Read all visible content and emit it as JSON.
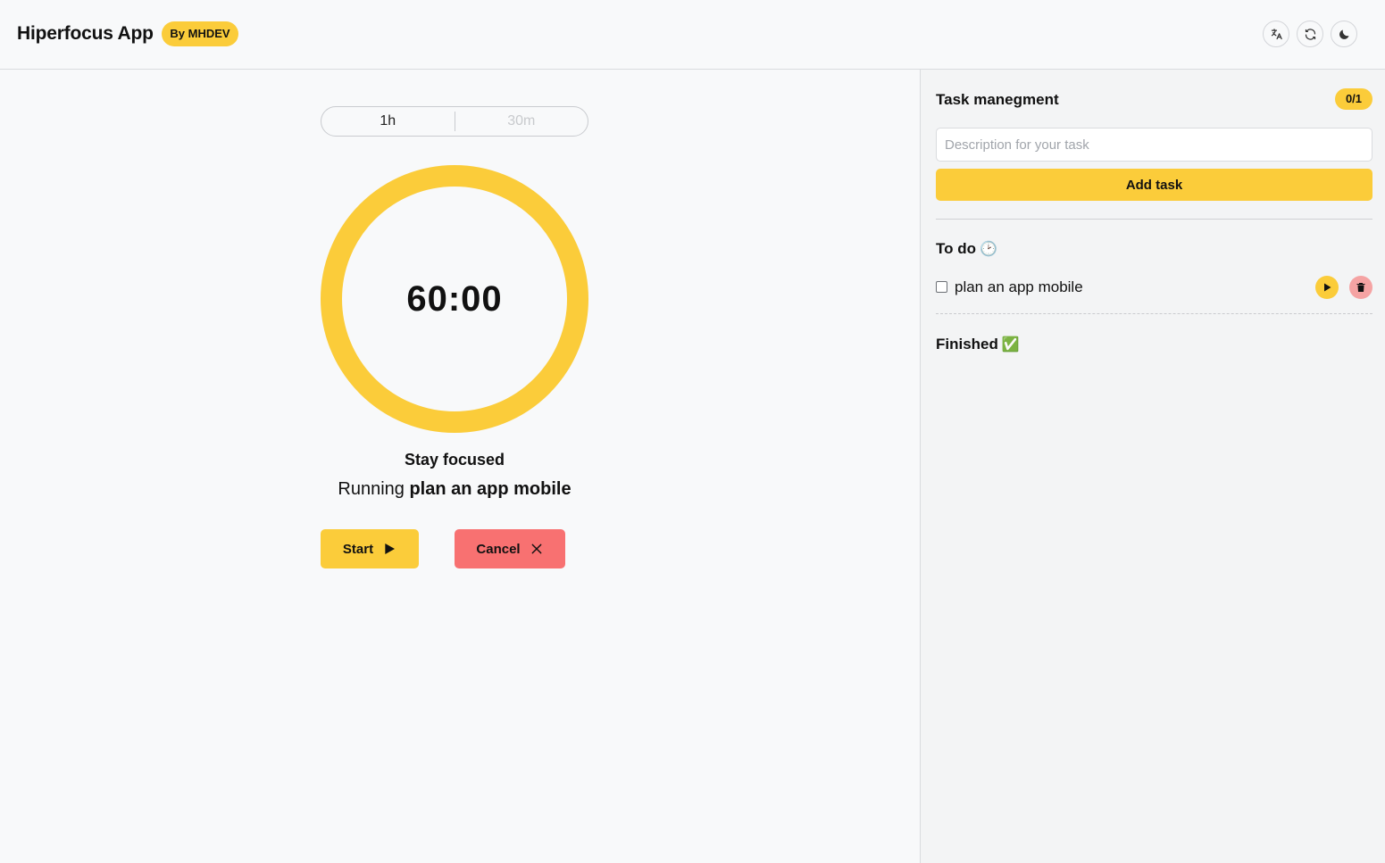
{
  "header": {
    "title": "Hiperfocus App",
    "badge": "By MHDEV",
    "buttons": [
      {
        "icon": "translate-icon"
      },
      {
        "icon": "refresh-icon"
      },
      {
        "icon": "moon-icon"
      }
    ]
  },
  "timer": {
    "durations": [
      {
        "label": "1h",
        "active": true
      },
      {
        "label": "30m",
        "active": false
      }
    ],
    "time": "60:00",
    "status": "Stay focused",
    "running_prefix": "Running",
    "running_task": "plan an app mobile",
    "start_label": "Start",
    "cancel_label": "Cancel"
  },
  "sidebar": {
    "title": "Task manegment",
    "count": "0/1",
    "input_placeholder": "Description for your task",
    "add_label": "Add task",
    "todo_heading": "To do",
    "todo_emoji": "🕑",
    "tasks": [
      {
        "label": "plan an app mobile",
        "done": false
      }
    ],
    "finished_heading": "Finished",
    "finished_emoji": "✅"
  },
  "colors": {
    "accent": "#fbcc3a",
    "danger": "#f87171",
    "delete_bg": "#f5a3a3",
    "background": "#f8f9fa",
    "sidebar_bg": "#f3f4f5"
  }
}
